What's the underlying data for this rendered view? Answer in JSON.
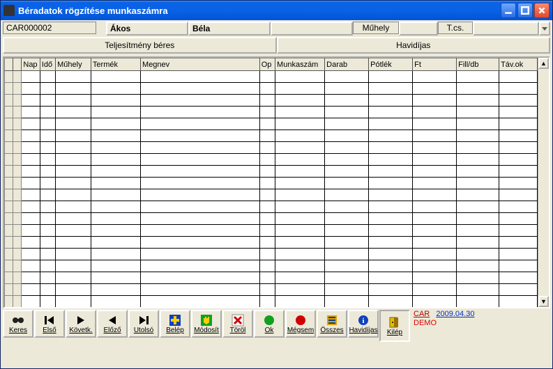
{
  "window": {
    "title": "Béradatok rögzítése munkaszámra"
  },
  "info": {
    "code": "CAR000002",
    "firstname": "Ákos",
    "lastname": "Béla",
    "workshop_label": "Műhely",
    "tcs_label": "T.cs."
  },
  "tabs": {
    "perf": "Teljesítmény béres",
    "monthly": "Havidíjas"
  },
  "columns": [
    "Nap",
    "Idő",
    "Műhely",
    "Termék",
    "Megnev",
    "Op",
    "Munkaszám",
    "Darab",
    "Pótlék",
    "Ft",
    "Fill/db",
    "Táv.ok"
  ],
  "toolbar": {
    "keres": "Keres",
    "elso": "Első",
    "kovetk": "Követk.",
    "elozo": "Előző",
    "utolso": "Utolsó",
    "belep": "Belép",
    "modosit": "Módosít",
    "torol": "Töröl",
    "ok": "Ok",
    "megsem": "Mégsem",
    "osszes": "Összes",
    "havidijas": "Havidíjas",
    "kilep": "Kilép"
  },
  "footer": {
    "car": "CAR",
    "date": "2009.04.30",
    "demo": "DEMO"
  }
}
